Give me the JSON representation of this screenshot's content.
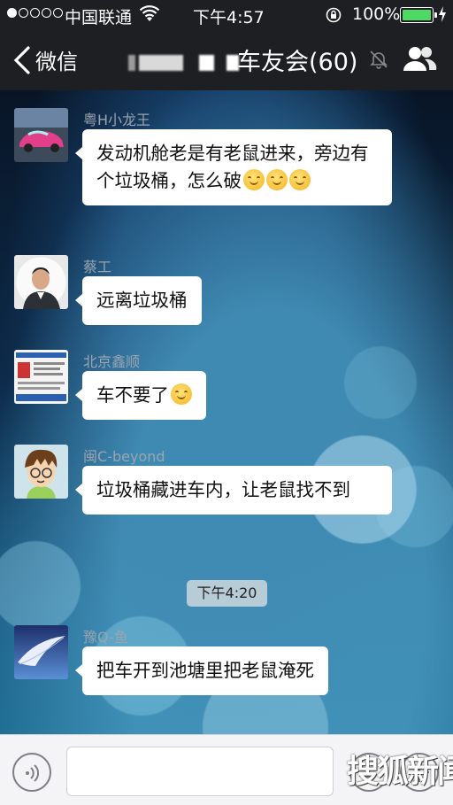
{
  "status_bar": {
    "signal_dots_filled": 1,
    "signal_dots_total": 5,
    "carrier": "中国联通",
    "time": "下午4:57",
    "battery_percent": "100%",
    "battery_color": "#4cd964",
    "icons": [
      "wifi-icon",
      "rotation-lock-icon",
      "battery-icon",
      "charging-icon"
    ]
  },
  "nav": {
    "back_label": "微信",
    "title": "车友会(60)",
    "title_note": "group name partially blurred",
    "icons": [
      "back-chevron-icon",
      "mute-bell-icon",
      "group-members-icon"
    ]
  },
  "messages": [
    {
      "sender": "粤H小龙王",
      "avatar": "pink-sports-car",
      "text": "发动机舱老是有老鼠进来，旁边有个垃圾桶，怎么破",
      "emojis": 3
    },
    {
      "sender": "蔡工",
      "avatar": "man-portrait",
      "text": "远离垃圾桶",
      "emojis": 0
    },
    {
      "sender": "北京鑫顺",
      "avatar": "business-card",
      "text": "车不要了",
      "emojis": 1
    },
    {
      "sender": "闽C-beyond",
      "avatar": "cartoon-boy",
      "text": "垃圾桶藏进车内，让老鼠找不到",
      "emojis": 0
    },
    {
      "sender": "豫Q-鱼",
      "avatar": "feather-sky",
      "text": "把车开到池塘里把老鼠淹死",
      "emojis": 0
    }
  ],
  "timestamp": "下午4:20",
  "input_bar": {
    "icons": [
      "voice-icon",
      "emoji-icon",
      "more-plus-icon"
    ]
  },
  "watermark": "搜狐新闻",
  "colors": {
    "bar_bg": "#1e1f22",
    "bubble_bg": "#ffffff",
    "name_text": "#9aa4ae",
    "input_bg": "#f4f4f6"
  }
}
